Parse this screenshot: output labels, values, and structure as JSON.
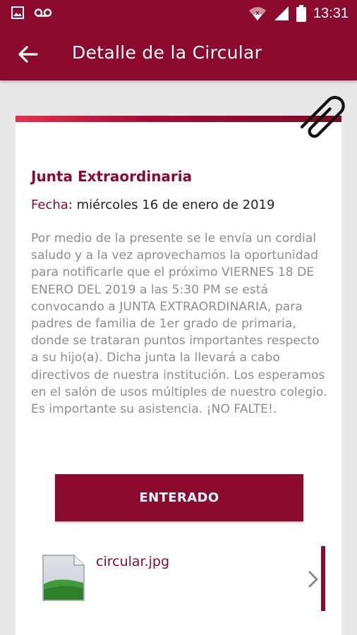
{
  "status_bar": {
    "time": "13:31",
    "left_icons": [
      "image-icon",
      "voicemail-icon"
    ],
    "right_icons": [
      "wifi-icon",
      "signal-icon",
      "battery-icon"
    ]
  },
  "app_bar": {
    "back_icon": "arrow-back-icon",
    "title": "Detalle de la Circular"
  },
  "circular": {
    "attachment_indicator_icon": "paperclip-icon",
    "title": "Junta Extraordinaria",
    "date_label": "Fecha",
    "date_value": "miércoles 16 de enero de 2019",
    "body": "Por medio de la presente se le envía un cordial saludo y a la vez aprovechamos la oportunidad para notificarle que el próximo VIERNES 18 DE ENERO DEL 2019 a las 5:30 PM se está convocando a JUNTA EXTRAORDINARIA, para padres de familia de 1er grado de primaria, donde se trataran puntos importantes respecto a su hijo(a). Dicha junta la llevará a cabo directivos de nuestra institución. Los esperamos en el salón de usos múltiples de nuestro colegio. Es importante su asistencia. ¡NO FALTE!.",
    "confirm_button": "ENTERADO",
    "attachment": {
      "file_name": "circular.jpg",
      "thumbnail_icon": "image-file-icon",
      "open_icon": "chevron-right-icon"
    }
  },
  "colors": {
    "primary": "#8c0a2e",
    "body_text": "#8e8e8e",
    "background": "#e8e8e8"
  }
}
